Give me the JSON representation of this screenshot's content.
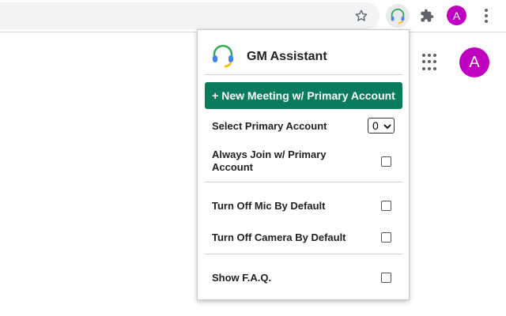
{
  "browser": {
    "profile_initial": "A"
  },
  "page": {
    "avatar_initial": "A"
  },
  "popup": {
    "title": "GM Assistant",
    "new_meeting_label": "+ New Meeting w/ Primary Account",
    "select_primary_label": "Select Primary Account",
    "select_primary_value": "0",
    "always_join_label": "Always Join w/ Primary Account",
    "always_join_checked": false,
    "mic_off_label": "Turn Off Mic By Default",
    "mic_off_checked": false,
    "camera_off_label": "Turn Off Camera By Default",
    "camera_off_checked": false,
    "faq_label": "Show F.A.Q.",
    "faq_checked": false
  },
  "colors": {
    "primary_button": "#0b7b5e",
    "avatar": "#c000c0"
  },
  "icons": [
    "star-icon",
    "headset-icon",
    "puzzle-icon",
    "more-vert-icon",
    "apps-grid-icon"
  ]
}
